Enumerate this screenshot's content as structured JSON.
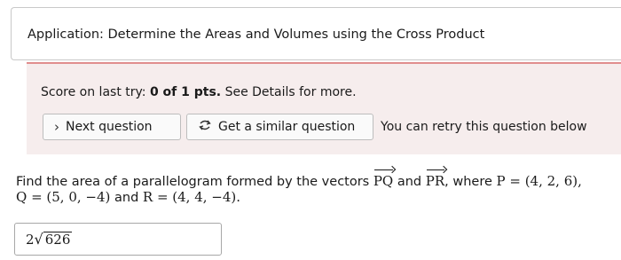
{
  "header": {
    "title": "Application: Determine the Areas and Volumes using the Cross Product"
  },
  "score": {
    "prefix": "Score on last try: ",
    "value": "0 of 1 pts.",
    "suffix": " See Details for more."
  },
  "actions": {
    "next_label": "Next question",
    "similar_label": "Get a similar question",
    "retry_text": "You can retry this question below"
  },
  "problem": {
    "intro": "Find the area of a parallelogram formed by the vectors ",
    "vec1": "PQ",
    "and": " and ",
    "vec2": "PR",
    "where": ", where ",
    "p": "P = (4, 2, 6),",
    "q": "Q = (5, 0, −4)",
    "and2": " and ",
    "r": "R = (4, 4, −4)."
  },
  "answer": {
    "coefficient": "2",
    "radical": "√",
    "radicand": "626"
  },
  "colors": {
    "panel_bg": "#f6eded",
    "panel_border": "#e08e8e"
  }
}
